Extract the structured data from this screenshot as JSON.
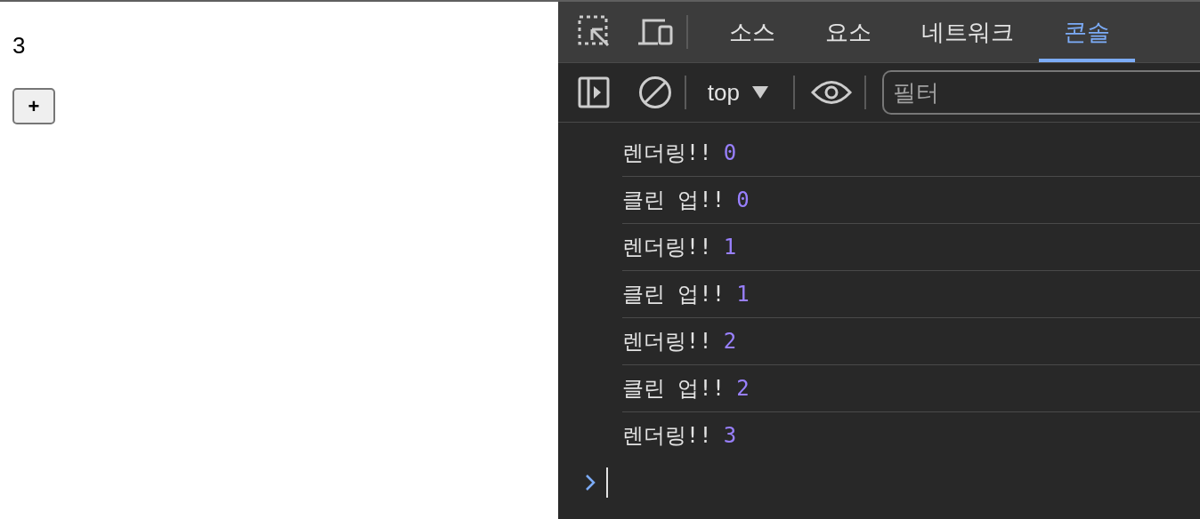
{
  "page": {
    "count": "3",
    "button": "+"
  },
  "devtools": {
    "tabs": [
      {
        "label": "소스",
        "selected": false
      },
      {
        "label": "요소",
        "selected": false
      },
      {
        "label": "네트워크",
        "selected": false
      },
      {
        "label": "콘솔",
        "selected": true
      }
    ],
    "context": "top",
    "filter": {
      "placeholder": "필터"
    },
    "logs": [
      {
        "message": "렌더링!!",
        "value": "0"
      },
      {
        "message": "클린 업!!",
        "value": "0"
      },
      {
        "message": "렌더링!!",
        "value": "1"
      },
      {
        "message": "클린 업!!",
        "value": "1"
      },
      {
        "message": "렌더링!!",
        "value": "2"
      },
      {
        "message": "클린 업!!",
        "value": "2"
      },
      {
        "message": "렌더링!!",
        "value": "3"
      }
    ]
  }
}
